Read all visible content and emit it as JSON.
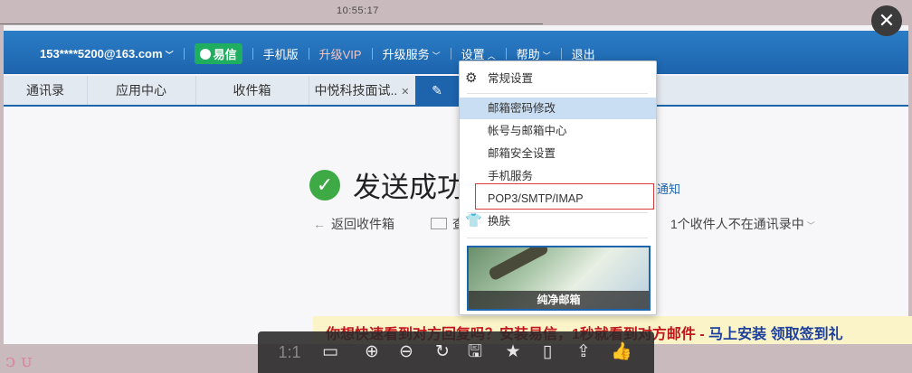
{
  "viewer": {
    "time": "10:55:17",
    "close_glyph": "✕",
    "toolbar": [
      {
        "name": "actual-size",
        "glyph": "1:1"
      },
      {
        "name": "fit-window",
        "glyph": "▭"
      },
      {
        "name": "zoom-in",
        "glyph": "⊕"
      },
      {
        "name": "zoom-out",
        "glyph": "⊖"
      },
      {
        "name": "rotate",
        "glyph": "↻"
      },
      {
        "name": "save",
        "glyph": "🖫"
      },
      {
        "name": "favorite",
        "glyph": "★"
      },
      {
        "name": "phone",
        "glyph": "▯"
      },
      {
        "name": "share",
        "glyph": "⇪"
      },
      {
        "name": "like",
        "glyph": "👍"
      }
    ]
  },
  "header": {
    "account": "153****5200@163.com",
    "yixin": "易信",
    "mobile": "手机版",
    "vip": "升级VIP",
    "upgrade": "升级服务",
    "settings": "设置",
    "help": "帮助",
    "logout": "退出"
  },
  "tabs": [
    "通讯录",
    "应用中心",
    "收件箱",
    "中悦科技面试.."
  ],
  "content": {
    "success": "发送成功",
    "notify": "通知",
    "back": "返回收件箱",
    "view": "查",
    "contacts_note": "1个收件人不在通讯录中"
  },
  "menu": {
    "general": "常规设置",
    "password": "邮箱密码修改",
    "account_center": "帐号与邮箱中心",
    "security": "邮箱安全设置",
    "phone": "手机服务",
    "pop3": "POP3/SMTP/IMAP",
    "skin": "换肤",
    "skin_name": "纯净邮箱"
  },
  "promo": {
    "text": "你想快速看到对方回复吗？安装易信，1秒就看到对方邮件 - ",
    "link": "马上安装  领取签到礼"
  }
}
